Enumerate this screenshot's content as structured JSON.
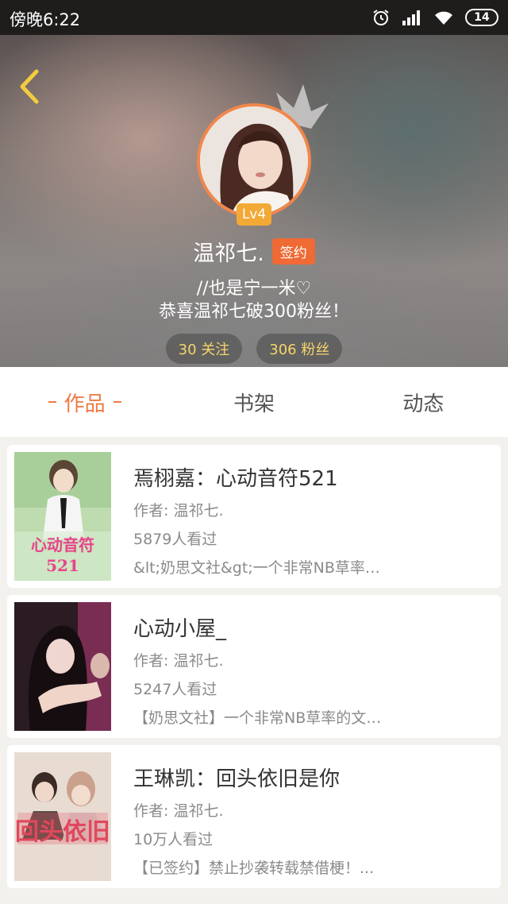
{
  "status_bar": {
    "time": "傍晚6:22",
    "battery": "14",
    "icons": [
      "alarm-icon",
      "signal-icon",
      "wifi-icon",
      "battery-icon"
    ]
  },
  "header": {
    "back_icon": "chevron-left-icon",
    "level": "Lv4",
    "username": "温祁七.",
    "signed_label": "签约",
    "bio_line1": "//也是宁一米♡",
    "bio_line2": "恭喜温祁七破300粉丝！",
    "following": "30 关注",
    "followers": "306 粉丝"
  },
  "tabs": [
    {
      "label": "作品",
      "active": true
    },
    {
      "label": "书架",
      "active": false
    },
    {
      "label": "动态",
      "active": false
    }
  ],
  "books": [
    {
      "title": "焉栩嘉：心动音符521",
      "author": "作者: 温祁七.",
      "views": "5879人看过",
      "description": "&lt;奶思文社&gt;一个非常NB草率…",
      "cover_text": "心动音符521"
    },
    {
      "title": "心动小屋_",
      "author": "作者: 温祁七.",
      "views": "5247人看过",
      "description": "【奶思文社】一个非常NB草率的文…"
    },
    {
      "title": "王琳凯：回头依旧是你",
      "author": "作者: 温祁七.",
      "views": "10万人看过",
      "description": "【已签约】禁止抄袭转载禁借梗！..."
    }
  ],
  "colors": {
    "accent": "#ee7a45",
    "signed_badge": "#ef6a35",
    "level_badge": "#f2a935",
    "stat_text": "#f8d56b"
  }
}
